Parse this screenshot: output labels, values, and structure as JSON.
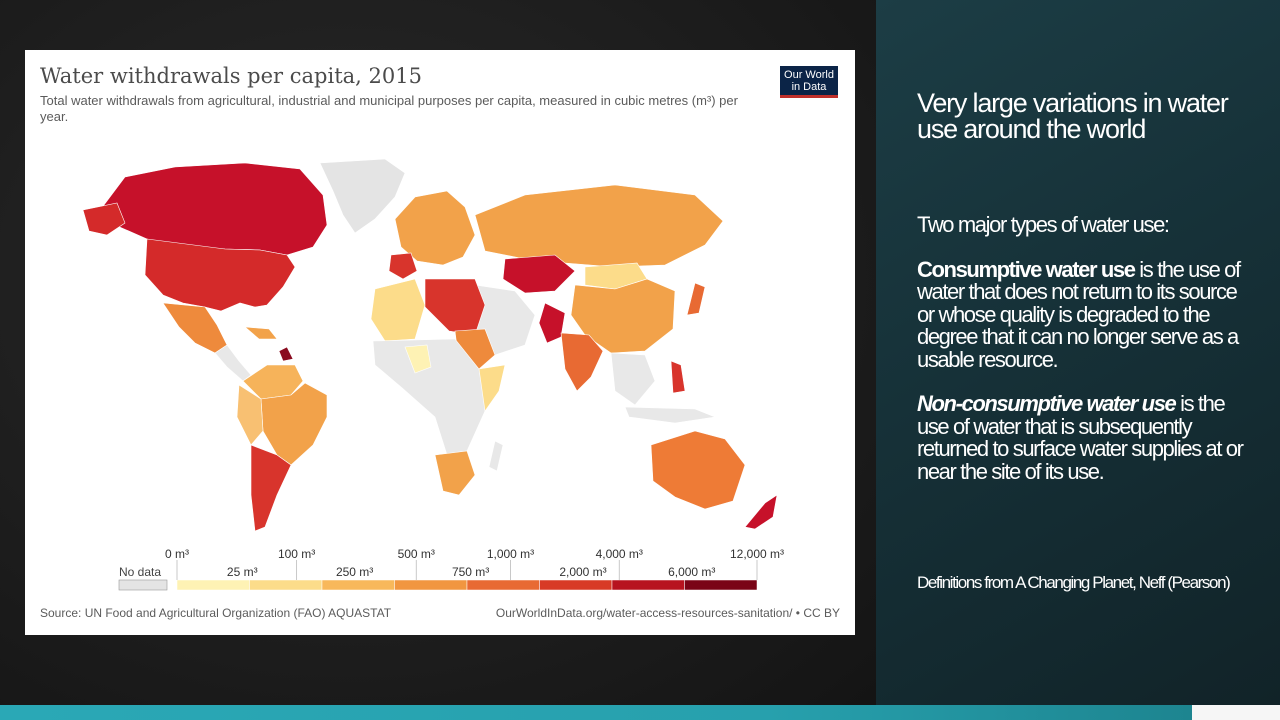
{
  "chart": {
    "title": "Water withdrawals per capita, 2015",
    "subtitle": "Total water withdrawals from agricultural, industrial and municipal purposes per capita, measured in cubic metres (m³) per year.",
    "logo_line1": "Our World",
    "logo_line2": "in Data",
    "source": "Source: UN Food and Agricultural Organization (FAO) AQUASTAT",
    "url": "OurWorldInData.org/water-access-resources-sanitation/ • CC BY",
    "legend": {
      "no_data": "No data",
      "upper_ticks": [
        "0 m³",
        "100 m³",
        "500 m³",
        "1,000 m³",
        "4,000 m³",
        "12,000 m³"
      ],
      "lower_ticks": [
        "25 m³",
        "250 m³",
        "750 m³",
        "2,000 m³",
        "6,000 m³"
      ],
      "colors": [
        "#fef2b4",
        "#fcdc8a",
        "#f8b85b",
        "#f19640",
        "#e86a33",
        "#d83a26",
        "#b7131f",
        "#7a0417"
      ],
      "no_data_color": "#e4e4e4"
    }
  },
  "slide": {
    "heading": "Very large variations in water use around the world",
    "intro": "Two major types of water use:",
    "consumptive_term": "Consumptive water use",
    "consumptive_def": " is the use of water that does not return to its source or whose quality is degraded to the degree that it can no longer serve as a usable resource.",
    "nonconsumptive_term": "Non-consumptive water use",
    "nonconsumptive_def": " is the use of water that is subsequently returned to surface water supplies at or near the site of its use.",
    "credit": "Definitions from A Changing Planet, Neff (Pearson)"
  }
}
